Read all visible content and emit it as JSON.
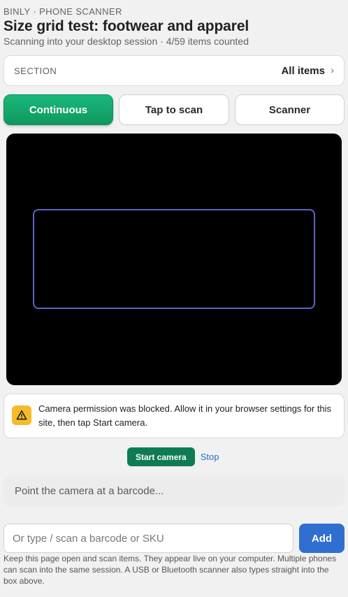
{
  "header": {
    "eyebrow": "BINLY · PHONE SCANNER",
    "title": "Size grid test: footwear and apparel",
    "subtitle": "Scanning into your desktop session · 4/59 items counted"
  },
  "section": {
    "label": "SECTION",
    "value": "All items",
    "chevron": "›"
  },
  "modes": [
    {
      "label": "Continuous",
      "active": true
    },
    {
      "label": "Tap to scan",
      "active": false
    },
    {
      "label": "Scanner",
      "active": false
    }
  ],
  "alert": {
    "icon": "warning-icon",
    "text": "Camera permission was blocked. Allow it in your browser settings for this site, then tap Start camera."
  },
  "camera_actions": {
    "start_label": "Start camera",
    "stop_label": "Stop"
  },
  "status": {
    "text": "Point the camera at a barcode..."
  },
  "entry": {
    "placeholder": "Or type / scan a barcode or SKU",
    "value": "",
    "add_label": "Add"
  },
  "help_text": "Keep this page open and scan items. They appear live on your computer. Multiple phones can scan into the same session. A USB or Bluetooth scanner also types straight into the box above.",
  "colors": {
    "accent_green": "#14a86e",
    "start_green": "#0f7b53",
    "add_blue": "#2f6fd0",
    "frame_blue": "#5b63c8",
    "warning_yellow": "#f7bb2a"
  }
}
